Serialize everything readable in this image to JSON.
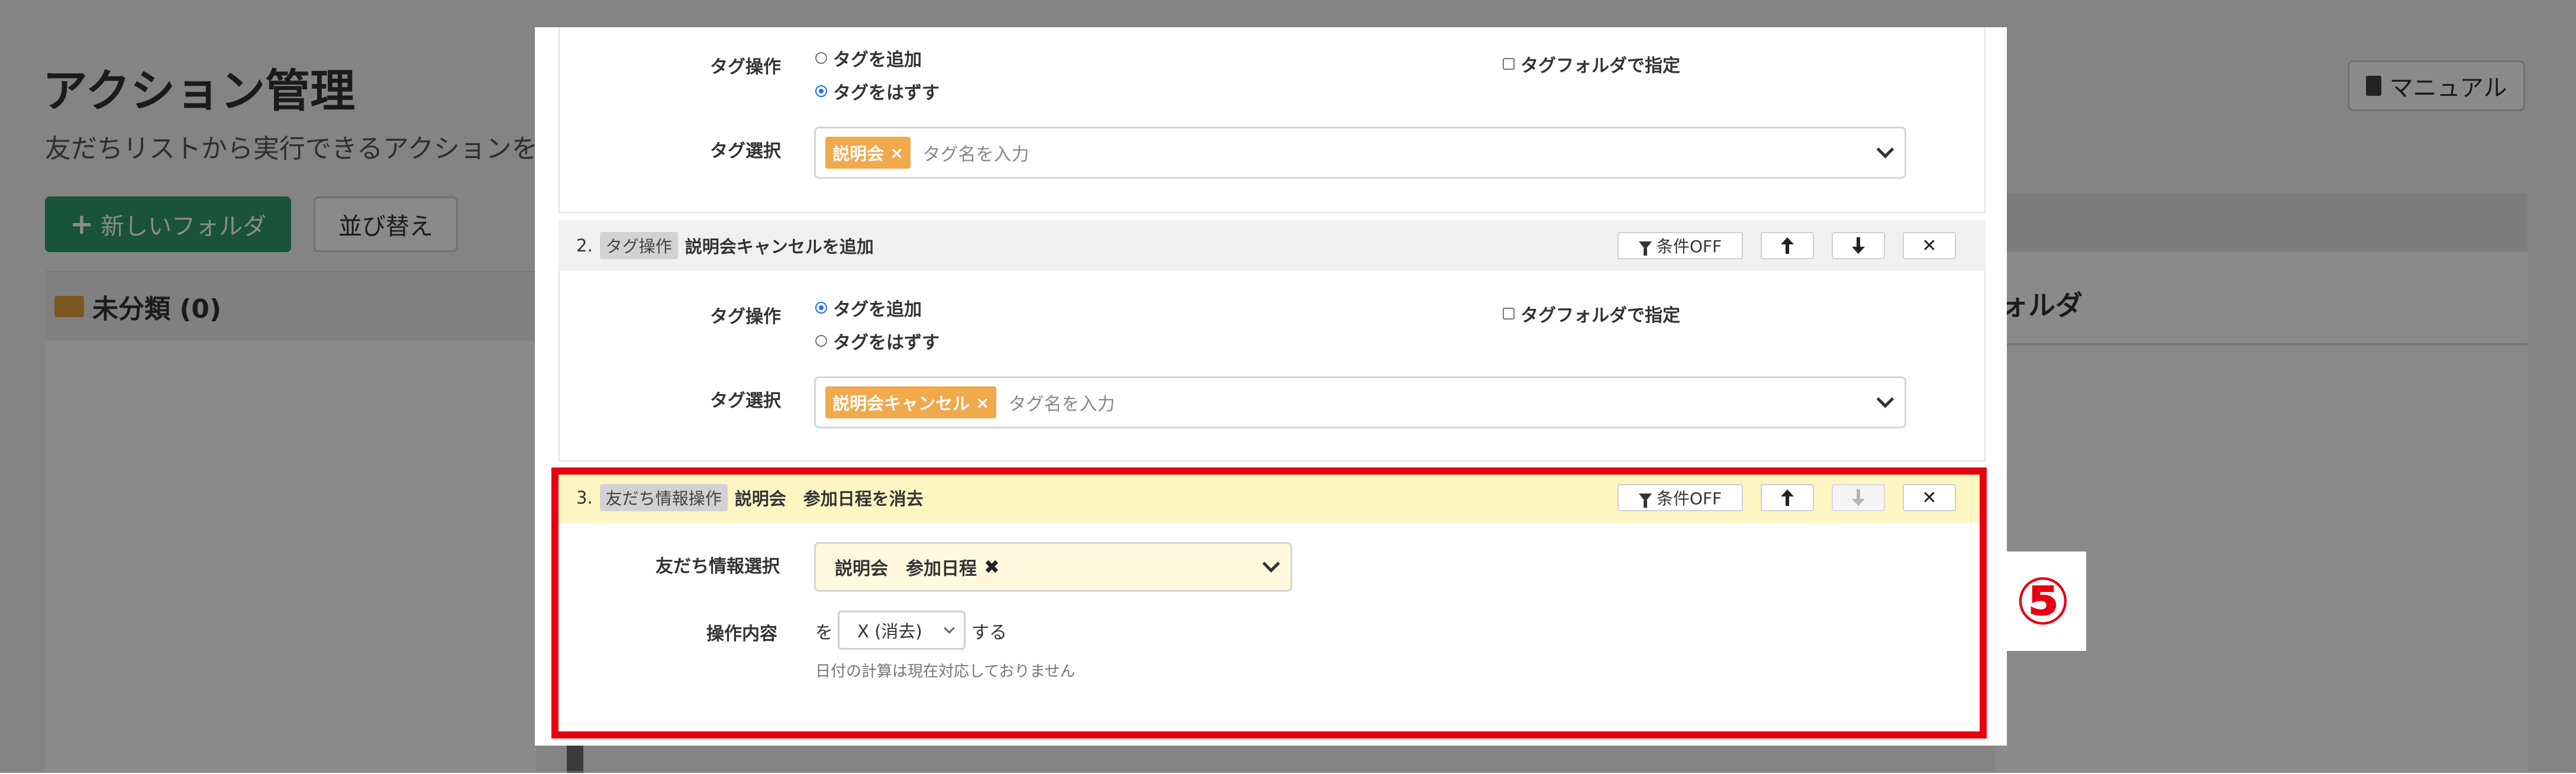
{
  "page": {
    "title": "アクション管理",
    "subtitle": "友だちリストから実行できるアクションを",
    "manual_button": "マニュアル",
    "new_folder_button": "新しいフォルダ",
    "sort_button": "並び替え",
    "folder_header": "未分類 (0)",
    "right_panel_title": "ォルダ"
  },
  "modal": {
    "step1": {
      "op_label": "タグ操作",
      "radio_add": "タグを追加",
      "radio_remove": "タグをはずす",
      "selected": "remove",
      "folder_checkbox": "タグフォルダで指定",
      "select_label": "タグ選択",
      "chip": "説明会",
      "placeholder": "タグ名を入力"
    },
    "step2": {
      "number": "2.",
      "badge": "タグ操作",
      "title": "説明会キャンセルを追加",
      "cond_button": "条件OFF",
      "op_label": "タグ操作",
      "radio_add": "タグを追加",
      "radio_remove": "タグをはずす",
      "selected": "add",
      "folder_checkbox": "タグフォルダで指定",
      "select_label": "タグ選択",
      "chip": "説明会キャンセル",
      "placeholder": "タグ名を入力"
    },
    "step3": {
      "number": "3.",
      "badge": "友だち情報操作",
      "title": "説明会　参加日程を消去",
      "cond_button": "条件OFF",
      "info_label": "友だち情報選択",
      "info_value": "説明会　参加日程",
      "op_label": "操作内容",
      "op_prefix": "を",
      "op_value": "X (消去)",
      "op_suffix": "する",
      "note": "日付の計算は現在対応しておりません"
    }
  },
  "callout_number": "⑤",
  "colors": {
    "highlight_red": "#e60012",
    "tag_chip": "#f0a94b",
    "radio_checked": "#1a73e8",
    "step3_header": "#fdf6c2",
    "green_button": "#2f9a6e"
  }
}
